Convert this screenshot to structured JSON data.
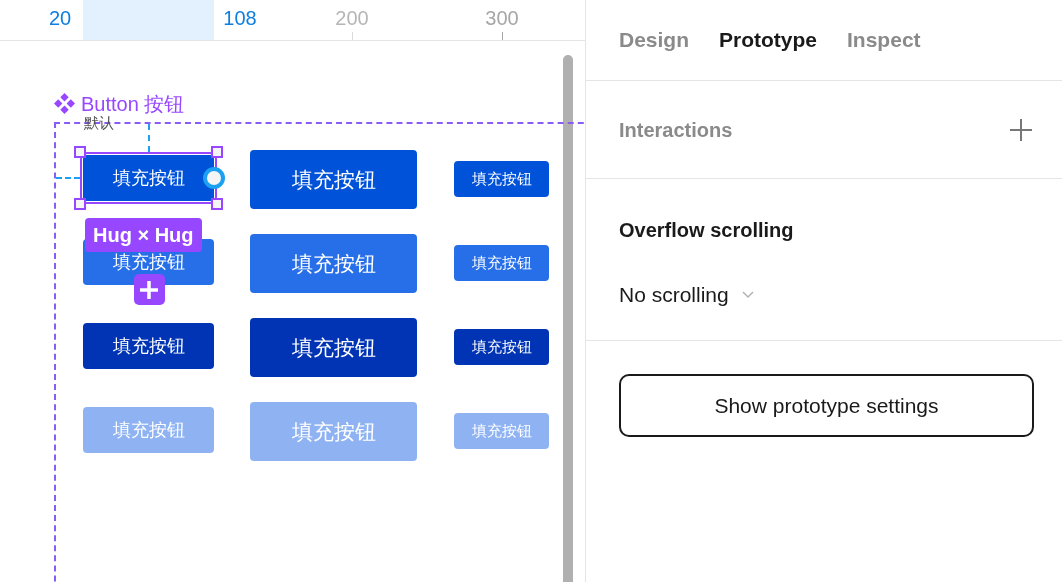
{
  "ruler": {
    "marks": [
      {
        "label": "20",
        "kind": "selection"
      },
      {
        "label": "108",
        "kind": "selection"
      },
      {
        "label": "200",
        "kind": "faded"
      },
      {
        "label": "300",
        "kind": "normal"
      }
    ]
  },
  "canvas": {
    "component": {
      "title": "Button 按钮",
      "variant_label": "默认",
      "size_badge": "Hug × Hug",
      "rows": [
        {
          "kind": "default",
          "buttons": [
            {
              "label": "填充按钮",
              "selected": true
            },
            {
              "label": "填充按钮",
              "selected": false
            },
            {
              "label": "填充按钮",
              "selected": false
            }
          ]
        },
        {
          "kind": "hover",
          "buttons": [
            {
              "label": "填充按钮",
              "selected": false
            },
            {
              "label": "填充按钮",
              "selected": false
            },
            {
              "label": "填充按钮",
              "selected": false
            }
          ]
        },
        {
          "kind": "pressed",
          "buttons": [
            {
              "label": "填充按钮",
              "selected": false
            },
            {
              "label": "填充按钮",
              "selected": false
            },
            {
              "label": "填充按钮",
              "selected": false
            }
          ]
        },
        {
          "kind": "disabled",
          "buttons": [
            {
              "label": "填充按钮",
              "selected": false
            },
            {
              "label": "填充按钮",
              "selected": false
            },
            {
              "label": "填充按钮",
              "selected": false
            }
          ]
        }
      ]
    }
  },
  "panel": {
    "tabs": [
      {
        "label": "Design",
        "selected": false
      },
      {
        "label": "Prototype",
        "selected": true
      },
      {
        "label": "Inspect",
        "selected": false
      }
    ],
    "interactions": {
      "title": "Interactions"
    },
    "overflow": {
      "title": "Overflow scrolling",
      "value": "No scrolling"
    },
    "settings_button": "Show prototype settings"
  }
}
